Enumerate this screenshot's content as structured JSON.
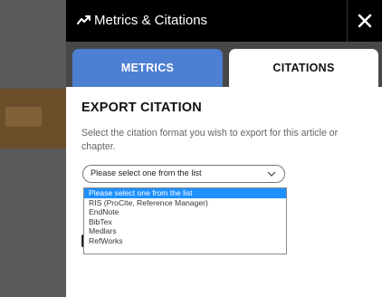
{
  "header": {
    "title": "Metrics & Citations",
    "icon": "trending-icon",
    "close_icon": "close-icon"
  },
  "tabs": [
    {
      "label": "METRICS",
      "active": false,
      "color": "#4d7fd2"
    },
    {
      "label": "CITATIONS",
      "active": true
    }
  ],
  "content": {
    "heading": "EXPORT CITATION",
    "description": "Select the citation format you wish to export for this article or chapter.",
    "select": {
      "value": "Please select one from the list",
      "options": [
        "Please select one from the list",
        "RIS (ProCite, Reference Manager)",
        "EndNote",
        "BibTex",
        "Medlars",
        "RefWorks"
      ],
      "highlighted_index": 0,
      "highlight_color": "#1e90ff"
    }
  }
}
